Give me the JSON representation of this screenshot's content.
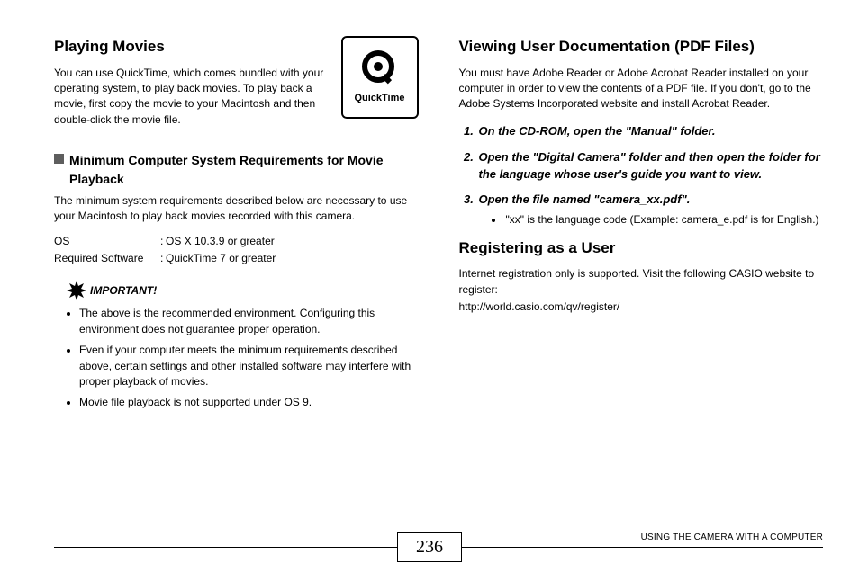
{
  "left": {
    "h1": "Playing Movies",
    "intro": "You can use QuickTime, which comes bundled with your operating system, to play back movies. To play back a movie, first copy the movie to your Macintosh and then double-click the movie file.",
    "qt_label": "QuickTime",
    "sub1": "Minimum Computer System Requirements for Movie Playback",
    "sub1_body": "The minimum system requirements described below are necessary to use your Macintosh to play back movies recorded with this camera.",
    "req": {
      "os_k": "OS",
      "os_v": "OS X 10.3.9 or greater",
      "sw_k": "Required Software",
      "sw_v": "QuickTime 7 or greater"
    },
    "important_label": "IMPORTANT!",
    "important_items": [
      "The above is the recommended environment. Configuring this environment does not guarantee proper operation.",
      "Even if your computer meets the minimum requirements described above, certain settings and other installed software may interfere with proper playback of movies.",
      "Movie file playback is not supported under OS 9."
    ]
  },
  "right": {
    "h1": "Viewing User Documentation (PDF Files)",
    "intro": "You must have Adobe Reader or Adobe Acrobat Reader installed on your computer in order to view the contents of a PDF file. If you don't, go to the Adobe Systems Incorporated website and install Acrobat Reader.",
    "steps": [
      "On the CD-ROM, open the \"Manual\" folder.",
      "Open the \"Digital Camera\" folder and then open the folder for the language whose user's guide you want to view.",
      "Open the file named \"camera_xx.pdf\"."
    ],
    "step3_note": "\"xx\" is the language code (Example: camera_e.pdf is for English.)",
    "h2": "Registering as a User",
    "reg_body": "Internet registration only is supported. Visit the following CASIO website to register:",
    "reg_url": "http://world.casio.com/qv/register/"
  },
  "footer": {
    "page": "236",
    "section": "USING THE CAMERA WITH A COMPUTER"
  }
}
